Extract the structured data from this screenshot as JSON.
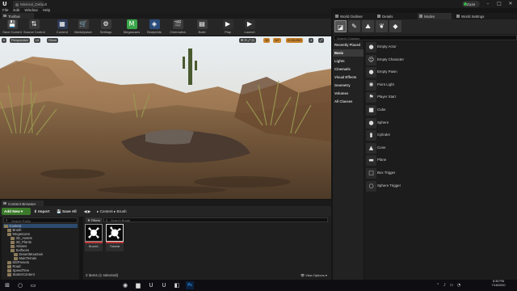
{
  "window": {
    "logo": "U",
    "doc_tab": "Minimal_Default",
    "user": "Zuze",
    "controls": {
      "minimize": "–",
      "maximize": "□",
      "close": "✕"
    }
  },
  "menu": [
    "File",
    "Edit",
    "Window",
    "Help"
  ],
  "toolbar": {
    "tab_label": "Toolbar",
    "buttons": [
      {
        "label": "Save Current",
        "icon": "save-icon",
        "glyph": "💾",
        "color": "#3a3a3a"
      },
      {
        "label": "Source Control",
        "icon": "source-control-icon",
        "glyph": "⇅",
        "color": "#3a3a3a"
      },
      {
        "label": "Content",
        "icon": "content-icon",
        "glyph": "▦",
        "color": "#2d3a55"
      },
      {
        "label": "Marketplace",
        "icon": "marketplace-icon",
        "glyph": "🛒",
        "color": "#3a3a3a"
      },
      {
        "label": "Settings",
        "icon": "settings-icon",
        "glyph": "⚙",
        "color": "#3a3a3a"
      },
      {
        "label": "Megascans",
        "icon": "megascans-icon",
        "glyph": "M",
        "color": "#3aa64a"
      },
      {
        "label": "Blueprints",
        "icon": "blueprints-icon",
        "glyph": "◈",
        "color": "#2a4c7a"
      },
      {
        "label": "Cinematics",
        "icon": "cinematics-icon",
        "glyph": "🎬",
        "color": "#3a3a3a"
      },
      {
        "label": "Build",
        "icon": "build-icon",
        "glyph": "▤",
        "color": "#3a3a3a"
      },
      {
        "label": "Play",
        "icon": "play-icon",
        "glyph": "▶",
        "color": "#2f2f2f"
      },
      {
        "label": "Launch",
        "icon": "launch-icon",
        "glyph": "▶",
        "color": "#2f2f2f"
      }
    ]
  },
  "viewport": {
    "view_mode_button": "Perspective",
    "lit_button": "Lit",
    "show_button": "Show",
    "grid_snap": "10",
    "rotation_snap": "10°",
    "scale_snap": "0.031250",
    "camera_speed": "4"
  },
  "content_browser": {
    "tab_label": "Content Browser",
    "add_new": "Add New",
    "import": "Import",
    "save_all": "Save All",
    "breadcrumb": [
      "Content",
      "Brush"
    ],
    "search_paths_placeholder": "Search Paths",
    "filters": "Filters",
    "search_placeholder": "Search Brush",
    "tree": [
      {
        "label": "Content",
        "indent": 0,
        "selected": true
      },
      {
        "label": "Brush",
        "indent": 1,
        "selected": false
      },
      {
        "label": "Megascans",
        "indent": 1,
        "selected": false
      },
      {
        "label": "3D_Assets",
        "indent": 2,
        "selected": false
      },
      {
        "label": "3D_Plants",
        "indent": 2,
        "selected": false
      },
      {
        "label": "Atlases",
        "indent": 2,
        "selected": false
      },
      {
        "label": "Surfaces",
        "indent": 2,
        "selected": false
      },
      {
        "label": "DesertMountain",
        "indent": 3,
        "selected": false
      },
      {
        "label": "MainTerrain",
        "indent": 3,
        "selected": false
      },
      {
        "label": "MSPresets",
        "indent": 1,
        "selected": false
      },
      {
        "label": "Road",
        "indent": 1,
        "selected": false
      },
      {
        "label": "SpeedTree",
        "indent": 1,
        "selected": false
      },
      {
        "label": "StarterContent",
        "indent": 1,
        "selected": false
      }
    ],
    "assets": [
      {
        "name": "Brush1"
      },
      {
        "name": "Tutorial"
      }
    ],
    "item_count": "2 items (1 selected)",
    "view_options": "View Options"
  },
  "right_panel": {
    "tabs": [
      "World Outliner",
      "Details",
      "Modes",
      "World Settings"
    ],
    "active_tab": "Modes",
    "modes": [
      {
        "icon": "place-mode-icon",
        "glyph": "◪"
      },
      {
        "icon": "paint-mode-icon",
        "glyph": "✎"
      },
      {
        "icon": "landscape-mode-icon",
        "glyph": "⛰"
      },
      {
        "icon": "foliage-mode-icon",
        "glyph": "❦"
      },
      {
        "icon": "geometry-mode-icon",
        "glyph": "◆"
      }
    ],
    "search_placeholder": "Search Classes",
    "categories": [
      "Recently Placed",
      "Basic",
      "Lights",
      "Cinematic",
      "Visual Effects",
      "Geometry",
      "Volumes",
      "All Classes"
    ],
    "active_category": "Basic",
    "items": [
      {
        "name": "Empty Actor",
        "icon": "sphere-icon",
        "glyph": "●"
      },
      {
        "name": "Empty Character",
        "icon": "character-icon",
        "glyph": "☺"
      },
      {
        "name": "Empty Pawn",
        "icon": "pawn-icon",
        "glyph": "●"
      },
      {
        "name": "Point Light",
        "icon": "point-light-icon",
        "glyph": "✺"
      },
      {
        "name": "Player Start",
        "icon": "player-start-icon",
        "glyph": "⚑"
      },
      {
        "name": "Cube",
        "icon": "cube-icon",
        "glyph": "■"
      },
      {
        "name": "Sphere",
        "icon": "sphere-shape-icon",
        "glyph": "●"
      },
      {
        "name": "Cylinder",
        "icon": "cylinder-icon",
        "glyph": "▮"
      },
      {
        "name": "Cone",
        "icon": "cone-icon",
        "glyph": "▲"
      },
      {
        "name": "Plane",
        "icon": "plane-icon",
        "glyph": "▬"
      },
      {
        "name": "Box Trigger",
        "icon": "box-trigger-icon",
        "glyph": "□"
      },
      {
        "name": "Sphere Trigger",
        "icon": "sphere-trigger-icon",
        "glyph": "○"
      }
    ]
  },
  "taskbar": {
    "time": "8:35 PM",
    "date": "7/16/2020",
    "apps": [
      {
        "icon": "windows-start-icon",
        "glyph": "⊞"
      },
      {
        "icon": "search-icon",
        "glyph": "○"
      },
      {
        "icon": "task-view-icon",
        "glyph": "▭"
      },
      {
        "icon": "chrome-icon",
        "glyph": "◉"
      },
      {
        "icon": "explorer-icon",
        "glyph": "▆"
      },
      {
        "icon": "unreal-icon",
        "glyph": "U"
      },
      {
        "icon": "unreal-editor-icon",
        "glyph": "U"
      },
      {
        "icon": "app-icon",
        "glyph": "◧"
      },
      {
        "icon": "photoshop-icon",
        "glyph": "Ps"
      }
    ],
    "tray": "⌃ ♪ ▭ ◔"
  }
}
